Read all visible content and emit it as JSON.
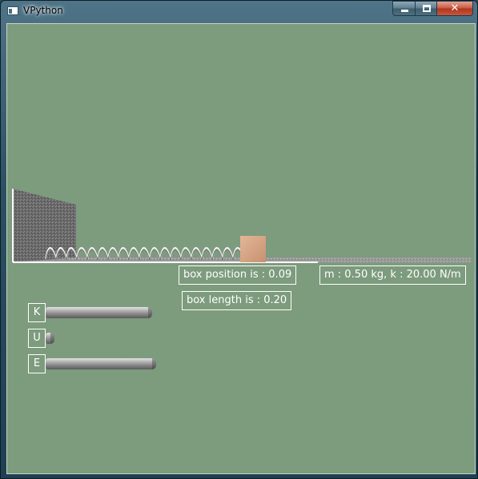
{
  "window": {
    "title": "VPython"
  },
  "controls": {
    "minimize_icon": "minimize-icon",
    "maximize_icon": "maximize-icon",
    "close_icon": "close-icon"
  },
  "labels": {
    "box_position": "box position is : 0.09",
    "params": "m : 0.50 kg, k : 20.00 N/m",
    "box_length": "box length is : 0.20"
  },
  "energy_bars": [
    {
      "key": "K",
      "level": 0.83
    },
    {
      "key": "U",
      "level": 0.07
    },
    {
      "key": "E",
      "level": 0.86
    }
  ],
  "colors": {
    "background": "#7d9b7d",
    "block": "#d8a88a",
    "label_border": "#ffffff"
  }
}
